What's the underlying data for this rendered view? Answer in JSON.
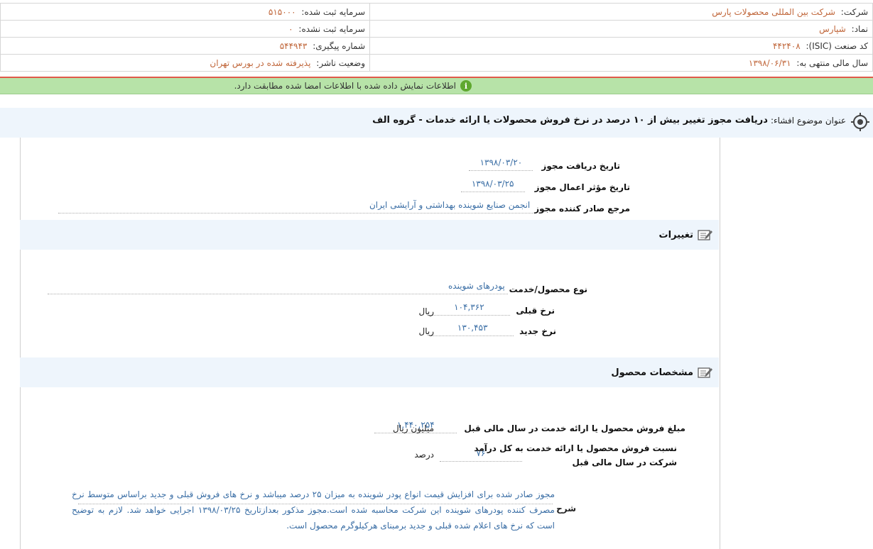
{
  "header": {
    "company_label": "شرکت:",
    "company_value": "شرکت بین المللی محصولات پارس",
    "registered_capital_label": "سرمایه ثبت شده:",
    "registered_capital_value": "۵۱۵۰۰۰",
    "symbol_label": "نماد:",
    "symbol_value": "شپارس",
    "unregistered_capital_label": "سرمایه ثبت نشده:",
    "unregistered_capital_value": "۰",
    "isic_label": "کد صنعت (ISIC):",
    "isic_value": "۴۴۲۴۰۸",
    "tracking_label": "شماره پیگیری:",
    "tracking_value": "۵۴۴۹۴۳",
    "fiscal_year_label": "سال مالی منتهی به:",
    "fiscal_year_value": "۱۳۹۸/۰۶/۳۱",
    "publisher_status_label": "وضعیت ناشر:",
    "publisher_status_value": "پذیرفته شده در بورس تهران"
  },
  "notice": {
    "message": "اطلاعات نمایش داده شده با اطلاعات امضا شده مطابقت دارد."
  },
  "title": {
    "label": "عنوان موضوع افشاء:",
    "text": "دریافت مجوز تغییر بیش از ۱۰ درصد در نرخ فروش محصولات یا ارائه خدمات - گروه الف"
  },
  "permit": {
    "receive_date_label": "تاریخ دریافت مجوز",
    "receive_date_value": "۱۳۹۸/۰۳/۲۰",
    "effective_date_label": "تاریخ مؤثر اعمال مجوز",
    "effective_date_value": "۱۳۹۸/۰۳/۲۵",
    "issuer_label": "مرجع صادر کننده مجوز",
    "issuer_value": "انجمن صنایع شوینده بهداشتی و آرایشی ایران"
  },
  "changes": {
    "heading": "تغییرات",
    "product_type_label": "نوع محصول/خدمت",
    "product_type_value": "پودرهای شوینده",
    "old_rate_label": "نرخ قبلی",
    "old_rate_value": "۱۰۴,۳۶۲",
    "old_rate_unit": "ریال",
    "new_rate_label": "نرخ جدید",
    "new_rate_value": "۱۳۰,۴۵۳",
    "new_rate_unit": "ریال"
  },
  "product": {
    "heading": "مشخصات محصول",
    "sales_label": "مبلغ فروش محصول یا ارائه خدمت در سال مالی قبل",
    "sales_value": "۱,۴۴۰,۲۵۴",
    "sales_unit": "میلیون ریال",
    "ratio_label_1": "نسبت فروش محصول یا ارائه خدمت به کل درآمد",
    "ratio_label_2": "شرکت در سال مالی قبل",
    "ratio_value": "۷۶",
    "ratio_unit": "درصد"
  },
  "description": {
    "label": "شرح",
    "text": "مجوز صادر شده برای افزایش قیمت انواع پودر شوینده به میزان ۲۵ درصد میباشد و نرخ های فروش قبلی و جدید براساس متوسط نرخ مصرف کننده پودرهای شوینده این شرکت محاسبه شده است.مجوز مذکور بعدازتاریخ ۱۳۹۸/۰۳/۲۵ اجرایی خواهد شد. لازم به توضیح است که نرخ های اعلام شده قبلی و جدید برمبنای هرکیلوگرم محصول است."
  },
  "colors": {
    "accent_value": "#c0663a",
    "link_blue": "#3a6ea5",
    "notice_green": "#b7e3a8",
    "section_bg": "#eef5fc",
    "red_rule": "#e05a4a"
  }
}
